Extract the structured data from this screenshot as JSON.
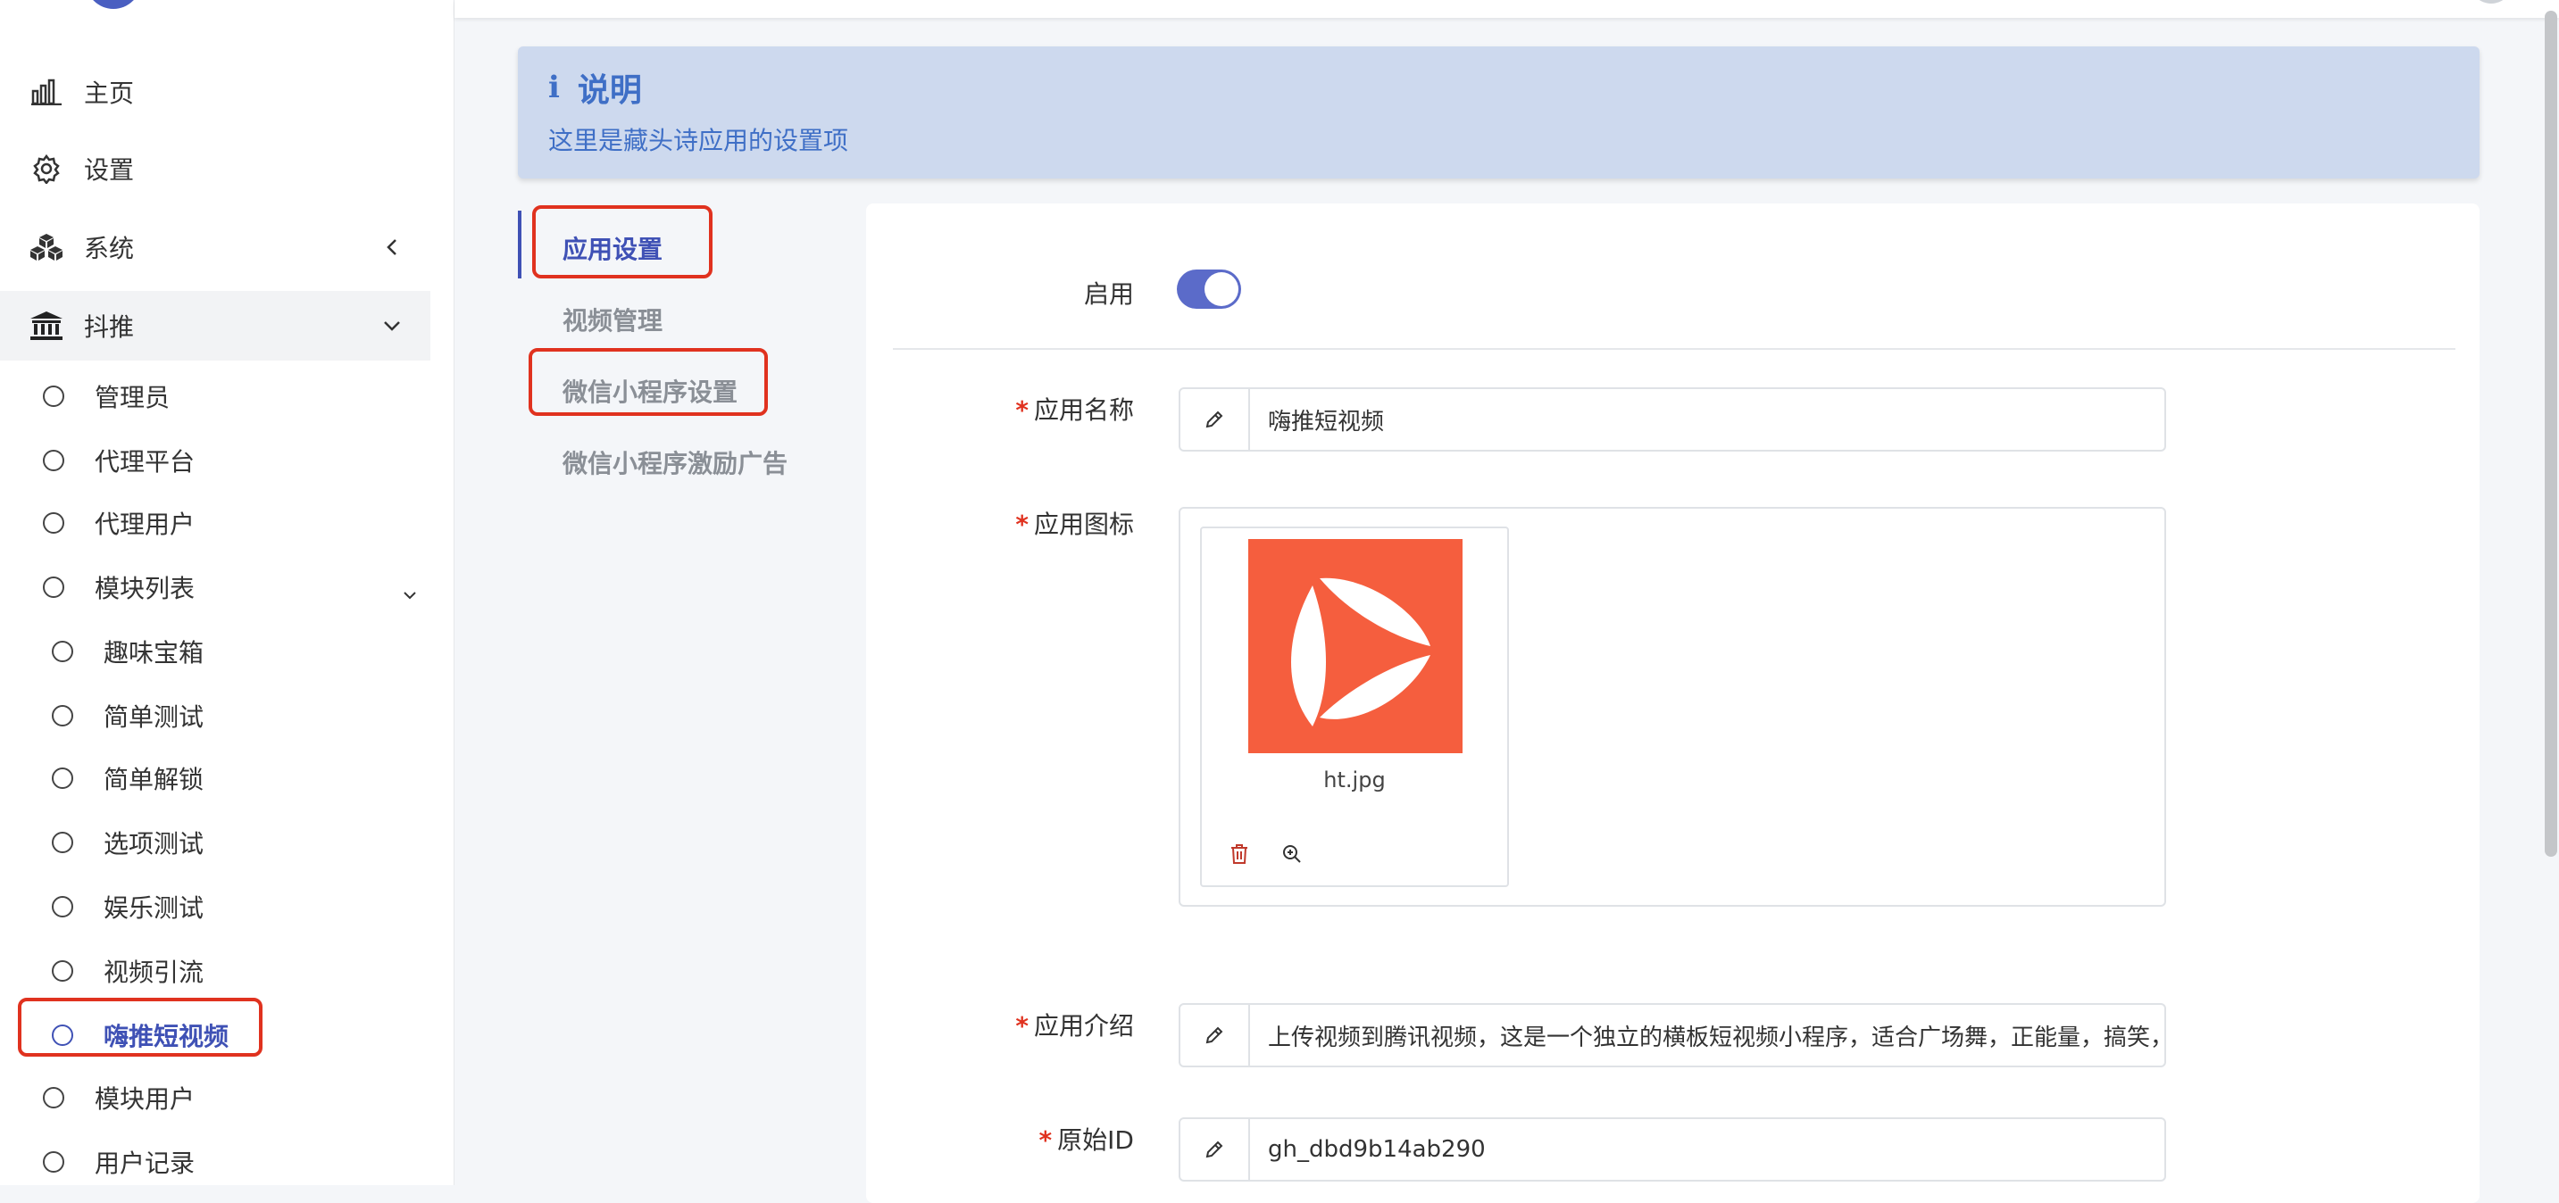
{
  "sidebar": {
    "menu": [
      {
        "label": "主页",
        "icon": "bar-chart-icon"
      },
      {
        "label": "设置",
        "icon": "gear-icon"
      },
      {
        "label": "系统",
        "icon": "cubes-icon"
      },
      {
        "label": "抖推",
        "icon": "bank-icon"
      }
    ],
    "douyin_children": [
      {
        "label": "管理员"
      },
      {
        "label": "代理平台"
      },
      {
        "label": "代理用户"
      },
      {
        "label": "模块列表"
      }
    ],
    "module_children": [
      {
        "label": "趣味宝箱"
      },
      {
        "label": "简单测试"
      },
      {
        "label": "简单解锁"
      },
      {
        "label": "选项测试"
      },
      {
        "label": "娱乐测试"
      },
      {
        "label": "视频引流"
      },
      {
        "label": "嗨推短视频"
      }
    ],
    "tail_children": [
      {
        "label": "模块用户"
      },
      {
        "label": "用户记录"
      }
    ],
    "highlight_color": "#e0321f",
    "accent_color": "#3f51b5"
  },
  "info": {
    "title": "说明",
    "description": "这里是藏头诗应用的设置项"
  },
  "tabs": [
    {
      "label": "应用设置"
    },
    {
      "label": "视频管理"
    },
    {
      "label": "微信小程序设置"
    },
    {
      "label": "微信小程序激励广告"
    }
  ],
  "form": {
    "enable_label": "启用",
    "enabled": true,
    "app_name_label": "应用名称",
    "app_name_value": "嗨推短视频",
    "app_icon_label": "应用图标",
    "app_icon_filename": "ht.jpg",
    "app_intro_label": "应用介绍",
    "app_intro_value": "上传视频到腾讯视频，这是一个独立的横板短视频小程序，适合广场舞，正能量，搞笑，：",
    "original_id_label": "原始ID",
    "original_id_value": "gh_dbd9b14ab290",
    "required_mark": "*"
  }
}
